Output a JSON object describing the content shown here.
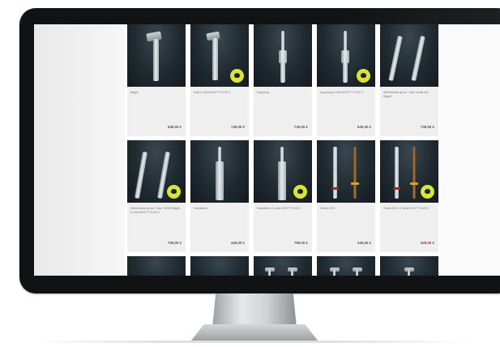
{
  "products": [
    {
      "name": "Bagell",
      "price": "549,00 €",
      "badge": false
    },
    {
      "name": "Kopf & Ultra BOS™ PLUS 2",
      "price": "749,00 €",
      "badge": true
    },
    {
      "name": "Kupplung",
      "price": "729,00 €",
      "badge": false
    },
    {
      "name": "Kupplung & Ultra BOS™ PLUS 2",
      "price": "549,00 €",
      "badge": true
    },
    {
      "name": "Winkelstück gross / Starr small line Bagell",
      "price": "749,00 €",
      "badge": false
    },
    {
      "name": "Winkelstück gross / Starr, WinE Bagell & Ultra BOS™ PLUS 2",
      "price": "759,00 €",
      "badge": true
    },
    {
      "name": "Handstück",
      "price": "449,00 €",
      "badge": false
    },
    {
      "name": "Handstück & Ultra BOS™ PLUS 2",
      "price": "799,00 €",
      "badge": true
    },
    {
      "name": "Scaler DE 2",
      "price": "249,00 €",
      "badge": false
    },
    {
      "name": "Scaler DE 2 & Ultra BOS™ PLUS 2",
      "price": "429,00 €",
      "badge": true
    }
  ],
  "colors": {
    "accent": "#9a2d5a",
    "badge": "#d8e43a",
    "card_bg": "#efefef",
    "image_bg": "#1f2a31"
  }
}
